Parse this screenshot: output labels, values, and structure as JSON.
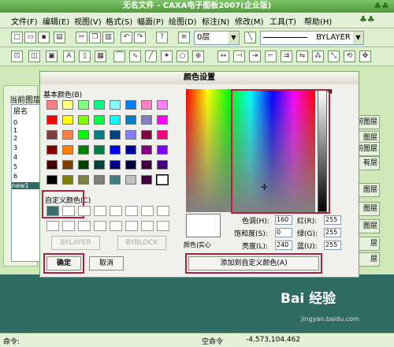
{
  "window": {
    "title": "无名文件 - CAXA电子图板2007(企业版)"
  },
  "menu": [
    "文件(F)",
    "编辑(E)",
    "视图(V)",
    "格式(S)",
    "幅面(P)",
    "绘图(D)",
    "标注(N)",
    "修改(M)",
    "工具(T)",
    "帮助(H)"
  ],
  "toolbar": {
    "layer_combo": "0层",
    "linetype_combo": "BYLAYER"
  },
  "left_panel": {
    "title": "当前图层",
    "header": "层名",
    "rows": [
      "0",
      "1",
      "2",
      "3",
      "4",
      "5",
      "6",
      "new1"
    ]
  },
  "right_buttons": [
    "前图层",
    "图层",
    "前图层",
    "有层",
    "图层",
    "图层",
    "图层",
    "层",
    "层"
  ],
  "dialog": {
    "title": "颜色设置",
    "basic_colors_label": "基本颜色(B)",
    "custom_colors_label": "自定义颜色(C)",
    "bylayer_btn": "BYLAYER",
    "byblock_btn": "BYBLOCK",
    "ok_btn": "确定",
    "cancel_btn": "取消",
    "preview_label": "颜色|实心",
    "add_custom_btn": "添加到自定义颜色(A)",
    "hue_label": "色调(H):",
    "hue": "160",
    "sat_label": "饱和度(S):",
    "sat": "0",
    "lum_label": "亮度(L):",
    "lum": "240",
    "red_label": "红(R):",
    "red": "255",
    "green_label": "绿(G):",
    "green": "255",
    "blue_label": "蓝(U):",
    "blue": "255"
  },
  "basic_colors": [
    "#ff8080",
    "#ffff80",
    "#80ff80",
    "#00ff80",
    "#80ffff",
    "#0080ff",
    "#ff80c0",
    "#ff80ff",
    "#ff0000",
    "#ffff00",
    "#80ff00",
    "#00ff40",
    "#00ffff",
    "#0080c0",
    "#8080c0",
    "#ff00ff",
    "#804040",
    "#ff8040",
    "#00ff00",
    "#008080",
    "#004080",
    "#8080ff",
    "#800040",
    "#ff0080",
    "#800000",
    "#ff8000",
    "#008000",
    "#008040",
    "#0000ff",
    "#0000a0",
    "#800080",
    "#8000ff",
    "#400000",
    "#804000",
    "#004000",
    "#004040",
    "#000080",
    "#000040",
    "#400040",
    "#400080",
    "#000000",
    "#808000",
    "#808040",
    "#808080",
    "#408080",
    "#c0c0c0",
    "#400040",
    "#ffffff"
  ],
  "custom_colors": [
    "#3c6e6e",
    "#ffffff",
    "#ffffff",
    "#ffffff",
    "#ffffff",
    "#ffffff",
    "#ffffff",
    "#ffffff",
    "#ffffff",
    "#ffffff",
    "#ffffff",
    "#ffffff",
    "#ffffff",
    "#ffffff",
    "#ffffff",
    "#ffffff"
  ],
  "status": {
    "left": "命令:",
    "mid": "空命令",
    "coords": "-4.573,104.462"
  },
  "watermark": {
    "brand": "Bai 经验",
    "url": "jingyan.baidu.com"
  }
}
